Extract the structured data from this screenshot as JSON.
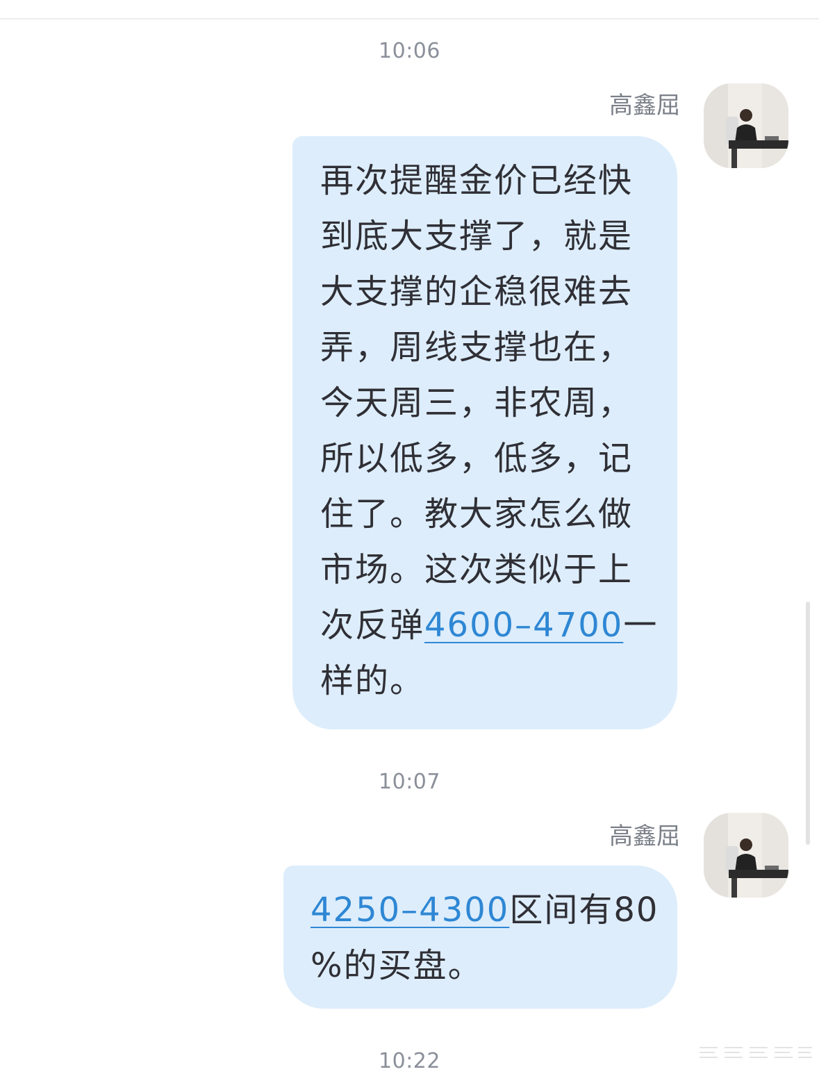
{
  "messages": [
    {
      "time": "10:06",
      "sender": "高鑫屈",
      "lines": [
        [
          {
            "text": "再次提醒金价已经快"
          }
        ],
        [
          {
            "text": "到底大支撑了，就是"
          }
        ],
        [
          {
            "text": "大支撑的企稳很难去"
          }
        ],
        [
          {
            "text": "弄，周线支撑也在，"
          }
        ],
        [
          {
            "text": "今天周三，非农周，"
          }
        ],
        [
          {
            "text": "所以低多，低多，记"
          }
        ],
        [
          {
            "text": "住了。教大家怎么做"
          }
        ],
        [
          {
            "text": "市场。这次类似于上"
          }
        ],
        [
          {
            "text": "次反弹"
          },
          {
            "text": "4600–4700",
            "link": true
          },
          {
            "text": "一"
          }
        ],
        [
          {
            "text": "样的。"
          }
        ]
      ]
    },
    {
      "time": "10:07",
      "sender": "高鑫屈",
      "lines": [
        [
          {
            "text": "4250–4300",
            "link": true
          },
          {
            "text": "区间有80"
          }
        ],
        [
          {
            "text": "%的买盘。"
          }
        ]
      ]
    }
  ],
  "footer_time": "10:22",
  "avatar_icon": "user-avatar-photo",
  "colors": {
    "bubble": "#ddedfb",
    "link": "#2e87d4",
    "timestamp": "#8a8f99",
    "sender": "#7a7f88"
  }
}
